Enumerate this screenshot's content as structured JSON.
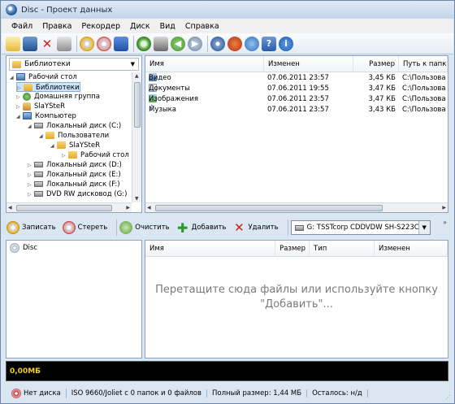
{
  "window": {
    "title": "Disc - Проект данных"
  },
  "menu": [
    "Файл",
    "Правка",
    "Рекордер",
    "Диск",
    "Вид",
    "Справка"
  ],
  "library_combo": {
    "value": "Библиотеки"
  },
  "tree": [
    {
      "label": "Рабочий стол"
    },
    {
      "label": "Библиотеки"
    },
    {
      "label": "Домашняя группа"
    },
    {
      "label": "SlaYSteR"
    },
    {
      "label": "Компьютер"
    },
    {
      "label": "Локальный диск (C:)"
    },
    {
      "label": "Пользователи"
    },
    {
      "label": "SlaYSteR"
    },
    {
      "label": "Рабочий стол"
    },
    {
      "label": "Локальный диск (D:)"
    },
    {
      "label": "Локальный диск (E:)"
    },
    {
      "label": "Локальный диск (F:)"
    },
    {
      "label": "DVD RW дисковод (G:)"
    }
  ],
  "file_list": {
    "headers": {
      "name": "Имя",
      "modified": "Изменен",
      "size": "Размер",
      "path": "Путь к папке"
    },
    "rows": [
      {
        "name": "Видео",
        "modified": "07.06.2011 23:57",
        "size": "3,45 КБ",
        "path": "C:\\Пользова"
      },
      {
        "name": "Документы",
        "modified": "07.06.2011 19:55",
        "size": "3,47 КБ",
        "path": "C:\\Пользова"
      },
      {
        "name": "Изображения",
        "modified": "07.06.2011 23:57",
        "size": "3,47 КБ",
        "path": "C:\\Пользова"
      },
      {
        "name": "Музыка",
        "modified": "07.06.2011 23:57",
        "size": "3,43 КБ",
        "path": "C:\\Пользова"
      }
    ]
  },
  "toolbar2": {
    "burn": "Записать",
    "erase": "Стереть",
    "clear": "Очистить",
    "add": "Добавить",
    "delete": "Удалить",
    "drive": "G: TSSTcorp CDDVDW SH-S223C"
  },
  "disc_tree": {
    "root": "Disc"
  },
  "disc_list": {
    "headers": {
      "name": "Имя",
      "size": "Размер",
      "type": "Тип",
      "modified": "Изменен"
    },
    "empty_message_line1": "Перетащите сюда файлы или используйте кнопку",
    "empty_message_line2": "\"Добавить\"..."
  },
  "capacity": {
    "used": "0,00МБ"
  },
  "status": {
    "disc": "Нет диска",
    "fs": "ISO 9660/Joliet с 0 папок и 0 файлов",
    "total": "Полный размер: 1,44 МБ",
    "remaining": "Осталось: н/д"
  },
  "icons": [
    "new-project-icon",
    "save-icon",
    "close-project-icon",
    "print-icon",
    "burn-icon",
    "erase-icon",
    "properties-icon",
    "copy-disc-icon",
    "image-icon",
    "back-icon",
    "forward-icon",
    "settings-icon",
    "record-icon",
    "web-icon",
    "help-icon",
    "info-icon"
  ]
}
